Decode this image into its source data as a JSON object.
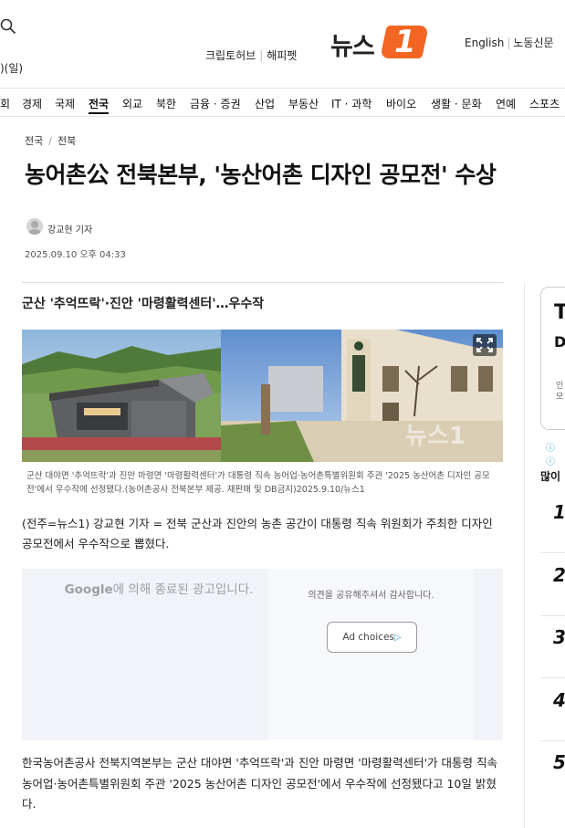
{
  "header": {
    "date_fragment": ")(일)",
    "links": [
      "크립토허브",
      "해피펫"
    ],
    "logo_text": "뉴스",
    "logo_number": "1",
    "lang": [
      "English",
      "노동신문"
    ]
  },
  "nav": {
    "items": [
      {
        "label": "회",
        "active": false
      },
      {
        "label": "경제",
        "active": false
      },
      {
        "label": "국제",
        "active": false
      },
      {
        "label": "전국",
        "active": true
      },
      {
        "label": "외교",
        "active": false
      },
      {
        "label": "북한",
        "active": false
      },
      {
        "label": "금융 · 증권",
        "active": false
      },
      {
        "label": "산업",
        "active": false
      },
      {
        "label": "부동산",
        "active": false
      },
      {
        "label": "IT · 과학",
        "active": false
      },
      {
        "label": "바이오",
        "active": false
      },
      {
        "label": "생활 · 문화",
        "active": false
      },
      {
        "label": "연예",
        "active": false
      },
      {
        "label": "스포츠",
        "active": false
      }
    ]
  },
  "article": {
    "breadcrumb": [
      "전국",
      "전북"
    ],
    "headline": "농어촌公 전북본부, '농산어촌 디자인 공모전' 수상",
    "reporter": "강교현 기자",
    "datetime": "2025.09.10 오후 04:33",
    "subhead": "군산 '추억뜨락'·진안 '마령활력센터'…우수작",
    "caption": "군산 대야면 '추억뜨락'과 진안 마령면 '마령활력센터'가 대통령 직속 농어업·농어촌특별위원회 주관 '2025 농산어촌 디자인 공모전'에서 우수작에 선정됐다.(농어촌공사 전북본부 제공. 재판매 및 DB금지)2025.9.10/뉴스1",
    "lead": "(전주=뉴스1) 강교현 기자 = 전북 군산과 진안의 농촌 공간이 대통령 직속 위원회가 주최한 디자인 공모전에서 우수작으로 뽑혔다.",
    "body": "한국농어촌공사 전북지역본부는 군산 대야면 '추억뜨락'과 진안 마령면 '마령활력센터'가 대통령 직속 농어업·농어촌특별위원회 주관 '2025 농산어촌 디자인 공모전'에서 우수작에 선정됐다고 10일 밝혔다."
  },
  "ad": {
    "google": "Google",
    "ended_text": "에 의해 종료된 광고입니다.",
    "thanks": "의견을 공유해주셔서 감사합니다.",
    "choices": "Ad choices",
    "photo_watermark": "뉴스1"
  },
  "sidebar": {
    "big1": "T",
    "big2": "D",
    "small": [
      "인",
      "모"
    ],
    "info": "ⓘ ⓘ",
    "title": "많이",
    "ranks": [
      "1",
      "2",
      "3",
      "4",
      "5"
    ]
  },
  "colors": {
    "brand": "#f26522",
    "ad_bg": "#f1f3f8",
    "adchoices": "#29a6d9"
  }
}
